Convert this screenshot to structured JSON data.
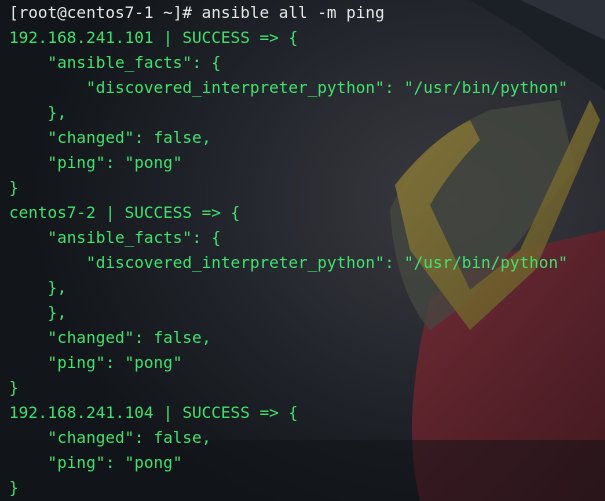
{
  "terminal": {
    "prompt": "[root@centos7-1 ~]# ",
    "command": "ansible all -m ping",
    "lines": [
      "192.168.241.101 | SUCCESS => {",
      "    \"ansible_facts\": {",
      "        \"discovered_interpreter_python\": \"/usr/bin/python\"",
      "    },",
      "    \"changed\": false,",
      "    \"ping\": \"pong\"",
      "}",
      "centos7-2 | SUCCESS => {",
      "    \"ansible_facts\": {",
      "        \"discovered_interpreter_python\": \"/usr/bin/python\"",
      "    },",
      "    },",
      "    \"changed\": false,",
      "    \"ping\": \"pong\"",
      "}",
      "192.168.241.104 | SUCCESS => {",
      "    \"changed\": false,",
      "    \"ping\": \"pong\"",
      "}"
    ]
  },
  "colors": {
    "background": "#14181c",
    "output_green": "#3fe26d",
    "prompt_text": "#e6e6e6"
  }
}
